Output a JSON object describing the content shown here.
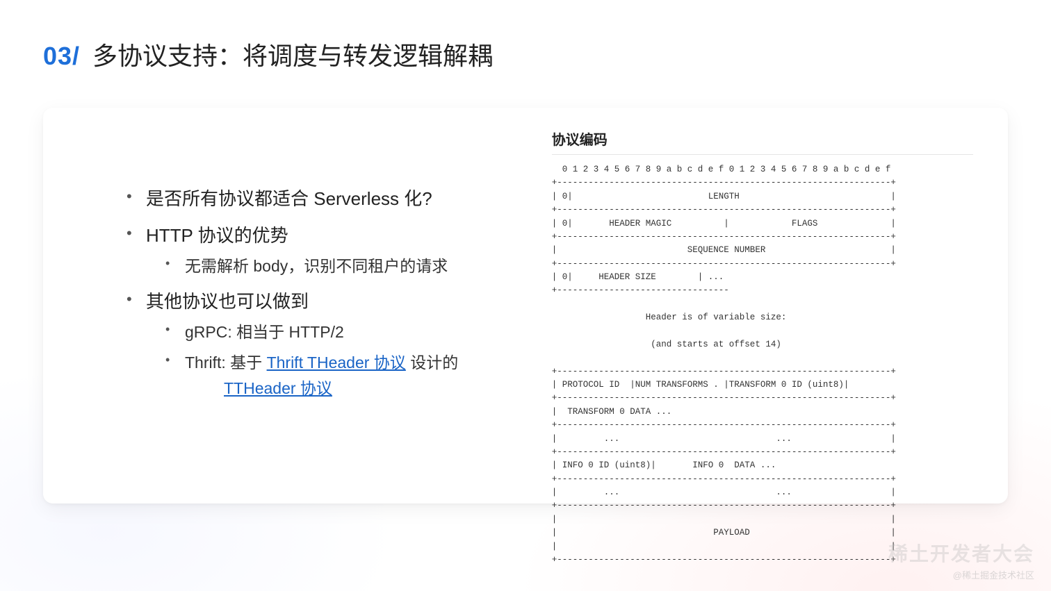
{
  "header": {
    "section_num": "03/",
    "title": "多协议支持：将调度与转发逻辑解耦"
  },
  "left": {
    "b1": "是否所有协议都适合 Serverless 化?",
    "b2": "HTTP 协议的优势",
    "b2_s1": "无需解析 body，识别不同租户的请求",
    "b3": "其他协议也可以做到",
    "b3_s1_pre": "gRPC: 相当于 HTTP/2",
    "b3_s2_pre": "Thrift: 基于 ",
    "b3_s2_link1": "Thrift THeader 协议",
    "b3_s2_mid": " 设计的",
    "b3_s2_link2": "TTHeader 协议"
  },
  "right": {
    "title": "协议编码",
    "ascii": "  0 1 2 3 4 5 6 7 8 9 a b c d e f 0 1 2 3 4 5 6 7 8 9 a b c d e f\n+----------------------------------------------------------------+\n| 0|                          LENGTH                             |\n+----------------------------------------------------------------+\n| 0|       HEADER MAGIC          |            FLAGS              |\n+----------------------------------------------------------------+\n|                         SEQUENCE NUMBER                        |\n+----------------------------------------------------------------+\n| 0|     HEADER SIZE        | ...\n+---------------------------------\n\n                  Header is of variable size:\n\n                   (and starts at offset 14)\n\n+----------------------------------------------------------------+\n| PROTOCOL ID  |NUM TRANSFORMS . |TRANSFORM 0 ID (uint8)|\n+----------------------------------------------------------------+\n|  TRANSFORM 0 DATA ...\n+----------------------------------------------------------------+\n|         ...                              ...                   |\n+----------------------------------------------------------------+\n| INFO 0 ID (uint8)|       INFO 0  DATA ...\n+----------------------------------------------------------------+\n|         ...                              ...                   |\n+----------------------------------------------------------------+\n|                                                                |\n|                              PAYLOAD                           |\n|                                                                |\n+----------------------------------------------------------------+"
  },
  "watermark": {
    "big": "稀土开发者大会",
    "small": "@稀土掘金技术社区"
  }
}
